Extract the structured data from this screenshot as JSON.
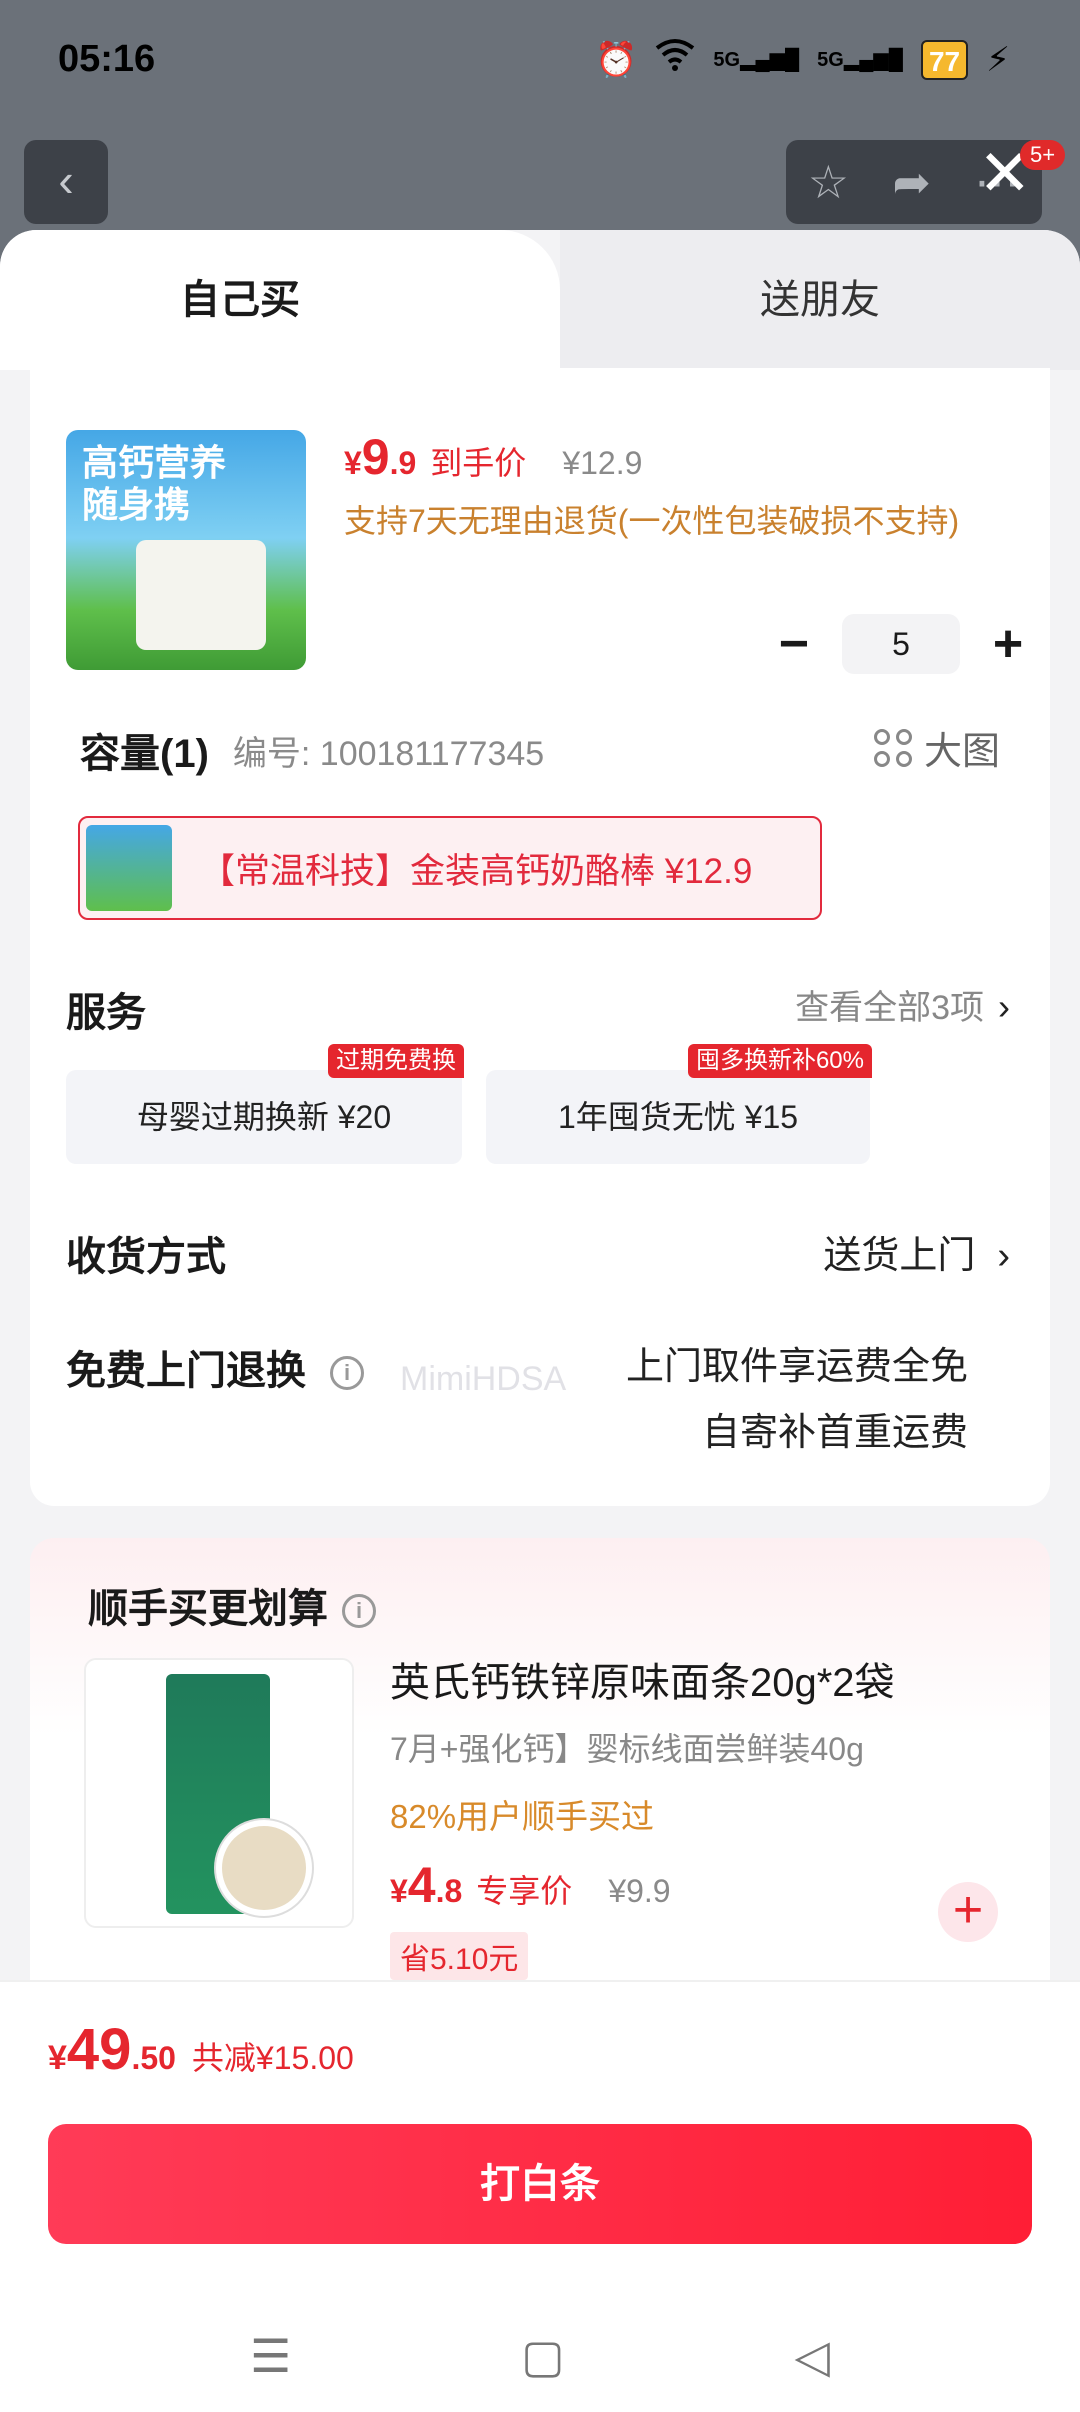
{
  "status_bar": {
    "time": "05:16",
    "battery": "77",
    "network1": "5G",
    "network2": "5G"
  },
  "top": {
    "more_badge": "5+"
  },
  "tabs": {
    "self": "自己买",
    "friend": "送朋友"
  },
  "product": {
    "image_text": "高钙营养随身携",
    "price_symbol": "¥",
    "price_int": "9",
    "price_dec": ".9",
    "price_label": "到手价",
    "orig_price": "¥12.9",
    "return_note": "支持7天无理由退货(一次性包装破损不支持)",
    "quantity": "5",
    "minus": "−",
    "plus": "+"
  },
  "spec": {
    "title": "容量(1)",
    "code": "编号: 100181177345",
    "big_image": "大图",
    "variant": "【常温科技】金装高钙奶酪棒  ¥12.9"
  },
  "services": {
    "title": "服务",
    "more": "查看全部3项",
    "items": [
      {
        "label": "母婴过期换新  ¥20",
        "tag": "过期免费换"
      },
      {
        "label": "1年囤货无忧  ¥15",
        "tag": "囤多换新补60%"
      }
    ]
  },
  "delivery": {
    "label": "收货方式",
    "value": "送货上门"
  },
  "free_return": {
    "label": "免费上门退换",
    "line1": "上门取件享运费全免",
    "line2": "自寄补首重运费"
  },
  "watermark": "MimiHDSA",
  "addon": {
    "title": "顺手买更划算",
    "name": "英氏钙铁锌原味面条20g*2袋",
    "sub": "7月+强化钙】婴标线面尝鲜装40g",
    "popular": "82%用户顺手买过",
    "price_symbol": "¥",
    "price_int": "4",
    "price_dec": ".8",
    "price_label": "专享价",
    "orig_price": "¥9.9",
    "save": "省5.10元",
    "add": "+"
  },
  "footer": {
    "total_symbol": "¥",
    "total_int": "49",
    "total_dec": ".50",
    "reduce": "共减¥15.00",
    "pay_button": "打白条"
  },
  "nav": {
    "menu": "☰",
    "home": "▢",
    "back": "◁"
  },
  "colors": {
    "accent": "#e5262e",
    "orange": "#c9812e",
    "button": "#ff2a45"
  }
}
